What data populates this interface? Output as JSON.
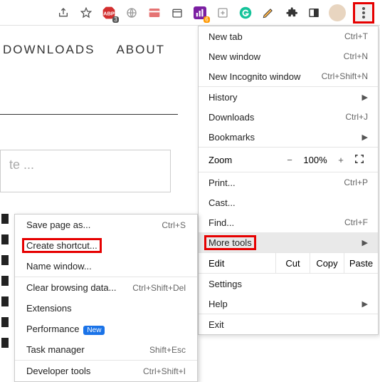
{
  "toolbar": {
    "abp_badge": "3",
    "ext_badge": "6"
  },
  "page": {
    "nav1": "DOWNLOADS",
    "nav2": "ABOUT",
    "placeholder": "te ..."
  },
  "menu": {
    "new_tab": "New tab",
    "new_tab_sc": "Ctrl+T",
    "new_window": "New window",
    "new_window_sc": "Ctrl+N",
    "incognito": "New Incognito window",
    "incognito_sc": "Ctrl+Shift+N",
    "history": "History",
    "downloads": "Downloads",
    "downloads_sc": "Ctrl+J",
    "bookmarks": "Bookmarks",
    "zoom": "Zoom",
    "zoom_minus": "−",
    "zoom_val": "100%",
    "zoom_plus": "+",
    "print": "Print...",
    "print_sc": "Ctrl+P",
    "cast": "Cast...",
    "find": "Find...",
    "find_sc": "Ctrl+F",
    "more_tools": "More tools",
    "edit": "Edit",
    "cut": "Cut",
    "copy": "Copy",
    "paste": "Paste",
    "settings": "Settings",
    "help": "Help",
    "exit": "Exit"
  },
  "submenu": {
    "save_page": "Save page as...",
    "save_page_sc": "Ctrl+S",
    "create_shortcut": "Create shortcut...",
    "name_window": "Name window...",
    "clear_data": "Clear browsing data...",
    "clear_data_sc": "Ctrl+Shift+Del",
    "extensions": "Extensions",
    "performance": "Performance",
    "new_badge": "New",
    "task_manager": "Task manager",
    "task_manager_sc": "Shift+Esc",
    "dev_tools": "Developer tools",
    "dev_tools_sc": "Ctrl+Shift+I"
  }
}
